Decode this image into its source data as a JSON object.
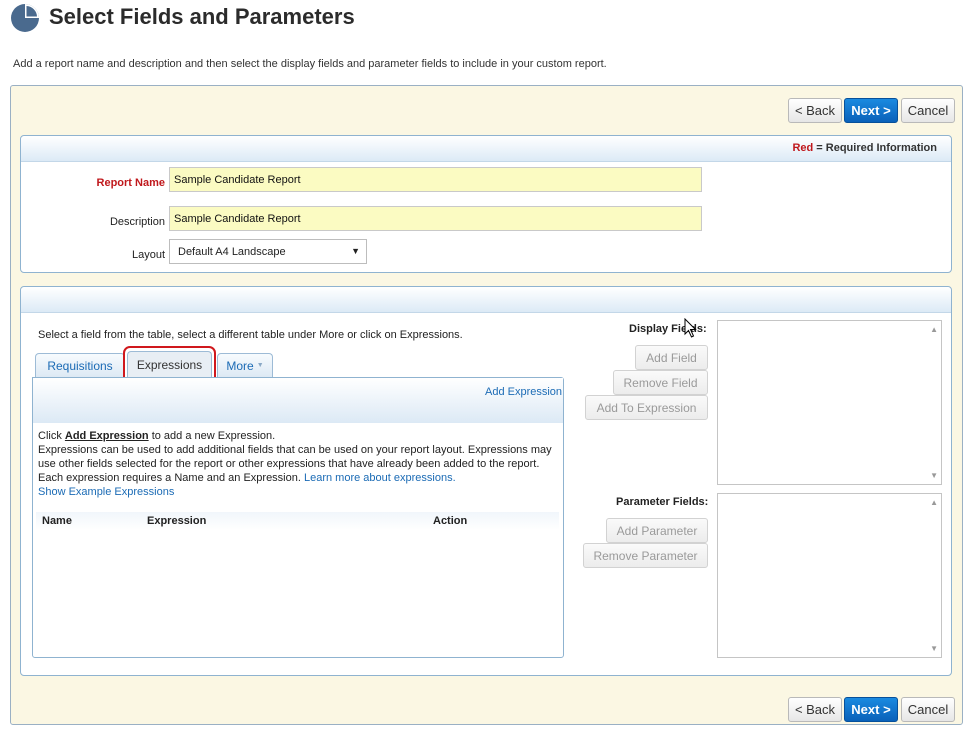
{
  "page": {
    "title": "Select Fields and Parameters",
    "intro": "Add a report name and description and then select the display fields and parameter fields to include in your custom report."
  },
  "nav": {
    "back": "< Back",
    "next": "Next >",
    "cancel": "Cancel"
  },
  "report_info": {
    "required_red": "Red",
    "required_rest": " = Required Information",
    "report_name_label": "Report Name",
    "report_name_value": "Sample Candidate Report",
    "description_label": "Description",
    "description_value": "Sample Candidate Report",
    "layout_label": "Layout",
    "layout_value": "Default A4 Landscape"
  },
  "fields": {
    "helper": "Select a field from the table, select a different table under More or click on Expressions.",
    "tabs": {
      "requisitions": "Requisitions",
      "expressions": "Expressions",
      "more": "More"
    },
    "add_expression_link": "Add Expression",
    "info": {
      "click": "Click ",
      "add_expression": "Add Expression",
      "to_add": " to add a new Expression.",
      "body": "Expressions can be used to add additional fields that can be used on your report layout. Expressions may use other fields selected for the report or other expressions that have already been added to the report. Each expression requires a Name and an Expression. ",
      "learn_more": "Learn more about expressions.",
      "show_examples": "Show Example Expressions"
    },
    "grid_columns": {
      "name": "Name",
      "expression": "Expression",
      "action": "Action"
    },
    "display_fields_label": "Display Fields:",
    "add_field": "Add Field",
    "remove_field": "Remove Field",
    "add_to_expression": "Add To Expression",
    "parameter_fields_label": "Parameter Fields:",
    "add_parameter": "Add Parameter",
    "remove_parameter": "Remove Parameter"
  },
  "colors": {
    "primary": "#0a61b9",
    "required": "#c0181c",
    "link": "#1b6bb5",
    "panel_bg": "#fbf7e3",
    "input_bg": "#fbfbc2"
  },
  "icons": {
    "logo": "pie-chart-icon",
    "cursor": "mouse-pointer-icon"
  }
}
